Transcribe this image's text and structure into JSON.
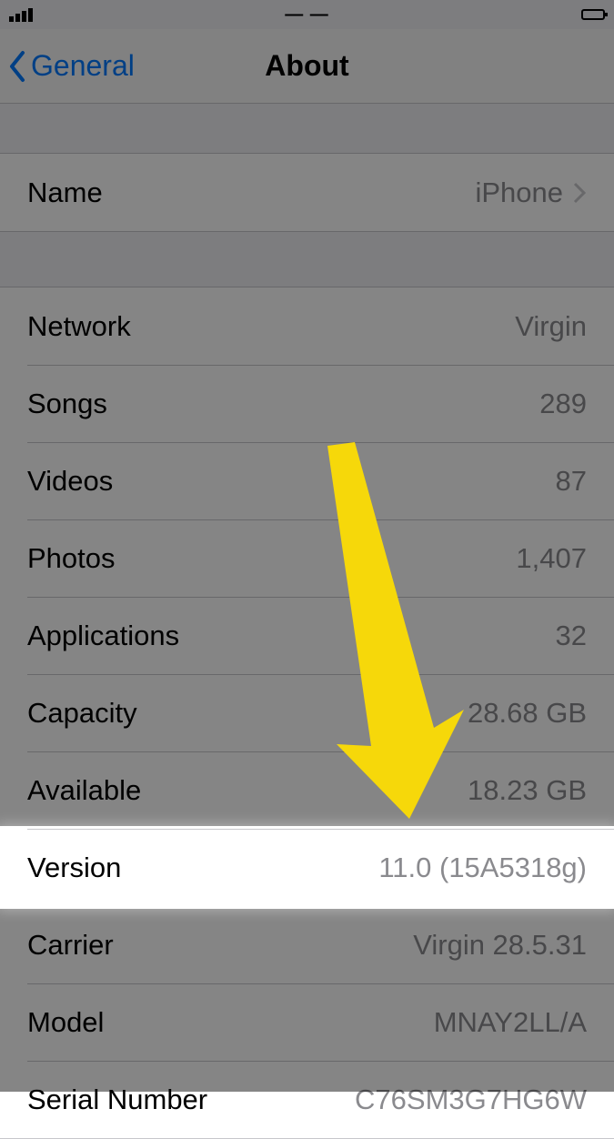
{
  "statusbar": {
    "carrier": "•••",
    "time": "— —",
    "battery": ""
  },
  "nav": {
    "back_label": "General",
    "title": "About"
  },
  "name_row": {
    "label": "Name",
    "value": "iPhone"
  },
  "rows": [
    {
      "label": "Network",
      "value": "Virgin"
    },
    {
      "label": "Songs",
      "value": "289"
    },
    {
      "label": "Videos",
      "value": "87"
    },
    {
      "label": "Photos",
      "value": "1,407"
    },
    {
      "label": "Applications",
      "value": "32"
    },
    {
      "label": "Capacity",
      "value": "28.68 GB"
    },
    {
      "label": "Available",
      "value": "18.23 GB"
    },
    {
      "label": "Version",
      "value": "11.0 (15A5318g)"
    },
    {
      "label": "Carrier",
      "value": "Virgin 28.5.31"
    },
    {
      "label": "Model",
      "value": "MNAY2LL/A"
    },
    {
      "label": "Serial Number",
      "value": "C76SM3G7HG6W"
    }
  ],
  "annotation": {
    "highlight_row_index": 7,
    "arrow_color": "#F6D80A"
  }
}
